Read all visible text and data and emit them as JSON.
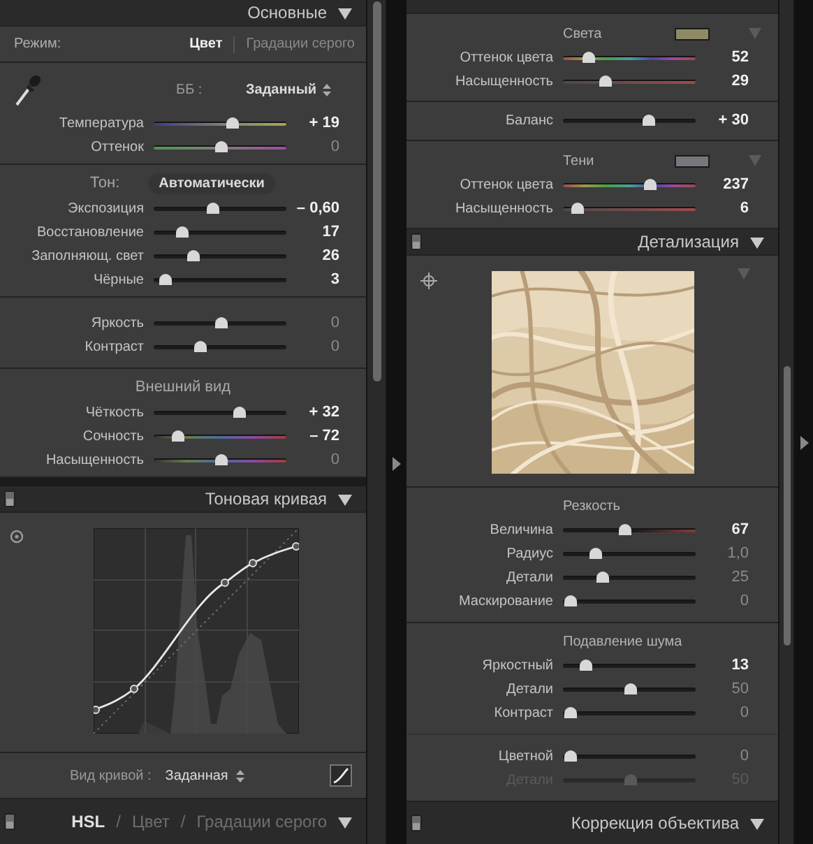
{
  "left_panel": {
    "basic": {
      "title": "Основные",
      "expanded": true,
      "mode_label": "Режим:",
      "mode_options": [
        {
          "label": "Цвет",
          "selected": true
        },
        {
          "label": "Градации серого",
          "selected": false
        }
      ],
      "wb_label": "ББ :",
      "wb_value": "Заданный",
      "groups": [
        {
          "kind": "wb",
          "sliders": [
            {
              "label": "Температура",
              "value": "+ 19",
              "level": 0.59,
              "kind": "temp",
              "modified": true,
              "disabled": false
            },
            {
              "label": "Оттенок",
              "value": "0",
              "level": 0.5,
              "kind": "tint",
              "modified": false,
              "disabled": false
            }
          ]
        },
        {
          "kind": "tone",
          "heading": "Тон:",
          "button": "Автоматически",
          "sliders": [
            {
              "label": "Экспозиция",
              "value": "– 0,60",
              "level": 0.44,
              "kind": "plain",
              "modified": true,
              "disabled": false
            },
            {
              "label": "Восстановление",
              "value": "17",
              "level": 0.21,
              "kind": "plain",
              "modified": true,
              "disabled": false
            },
            {
              "label": "Заполняющ. свет",
              "value": "26",
              "level": 0.29,
              "kind": "plain",
              "modified": true,
              "disabled": false
            },
            {
              "label": "Чёрные",
              "value": "3",
              "level": 0.08,
              "kind": "plain",
              "modified": true,
              "disabled": false
            }
          ]
        },
        {
          "kind": "plain",
          "sliders": [
            {
              "label": "Яркость",
              "value": "0",
              "level": 0.5,
              "kind": "plain",
              "modified": false,
              "disabled": false
            },
            {
              "label": "Контраст",
              "value": "0",
              "level": 0.35,
              "kind": "plain",
              "modified": false,
              "disabled": false
            }
          ]
        },
        {
          "kind": "presence",
          "heading": "Внешний вид",
          "sliders": [
            {
              "label": "Чёткость",
              "value": "+ 32",
              "level": 0.64,
              "kind": "plain",
              "modified": true,
              "disabled": false
            },
            {
              "label": "Сочность",
              "value": "– 72",
              "level": 0.18,
              "kind": "vibrance",
              "modified": true,
              "disabled": false
            },
            {
              "label": "Насыщенность",
              "value": "0",
              "level": 0.5,
              "kind": "vibrance",
              "modified": false,
              "disabled": false
            }
          ]
        }
      ]
    },
    "tone_curve": {
      "title": "Тоновая кривая",
      "expanded": true,
      "curve_label": "Вид кривой :",
      "curve_value": "Заданная"
    },
    "hsl": {
      "separator": "/",
      "expanded": true,
      "tabs": [
        {
          "label": "HSL",
          "selected": true
        },
        {
          "label": "Цвет",
          "selected": false
        },
        {
          "label": "Градации серого",
          "selected": false
        }
      ]
    }
  },
  "right_panel": {
    "split_toning": {
      "groups": [
        {
          "heading": "Света",
          "color": "#8e8a66",
          "sliders": [
            {
              "label": "Оттенок цвета",
              "value": "52",
              "level": 0.19,
              "kind": "hue",
              "modified": true,
              "disabled": false
            },
            {
              "label": "Насыщенность",
              "value": "29",
              "level": 0.32,
              "kind": "sat",
              "modified": true,
              "disabled": false
            }
          ]
        },
        {
          "sliders": [
            {
              "label": "Баланс",
              "value": "+ 30",
              "level": 0.64,
              "kind": "plain",
              "modified": true,
              "disabled": false
            }
          ]
        },
        {
          "heading": "Тени",
          "color": "#77767c",
          "sliders": [
            {
              "label": "Оттенок цвета",
              "value": "237",
              "level": 0.65,
              "kind": "hue",
              "modified": true,
              "disabled": false
            },
            {
              "label": "Насыщенность",
              "value": "6",
              "level": 0.11,
              "kind": "sat",
              "modified": true,
              "disabled": false
            }
          ]
        }
      ]
    },
    "detail": {
      "title": "Детализация",
      "expanded": true,
      "groups": [
        {
          "heading": "Резкость",
          "sliders": [
            {
              "label": "Величина",
              "value": "67",
              "level": 0.46,
              "kind": "amount",
              "modified": true,
              "disabled": false
            },
            {
              "label": "Радиус",
              "value": "1,0",
              "level": 0.24,
              "kind": "plain",
              "modified": false,
              "disabled": false
            },
            {
              "label": "Детали",
              "value": "25",
              "level": 0.29,
              "kind": "plain",
              "modified": false,
              "disabled": false
            },
            {
              "label": "Маскирование",
              "value": "0",
              "level": 0.05,
              "kind": "plain",
              "modified": false,
              "disabled": false
            }
          ]
        },
        {
          "heading": "Подавление шума",
          "sliders": [
            {
              "label": "Яркостный",
              "value": "13",
              "level": 0.17,
              "kind": "plain",
              "modified": true,
              "disabled": false
            },
            {
              "label": "Детали",
              "value": "50",
              "level": 0.5,
              "kind": "plain",
              "modified": false,
              "disabled": false
            },
            {
              "label": "Контраст",
              "value": "0",
              "level": 0.05,
              "kind": "plain",
              "modified": false,
              "disabled": false
            }
          ],
          "sub_sliders": [
            {
              "label": "Цветной",
              "value": "0",
              "level": 0.05,
              "kind": "plain",
              "modified": false,
              "disabled": false
            },
            {
              "label": "Детали",
              "value": "50",
              "level": 0.5,
              "kind": "plain",
              "modified": false,
              "disabled": true
            }
          ]
        }
      ]
    },
    "lens": {
      "title": "Коррекция объектива",
      "expanded": true
    }
  }
}
